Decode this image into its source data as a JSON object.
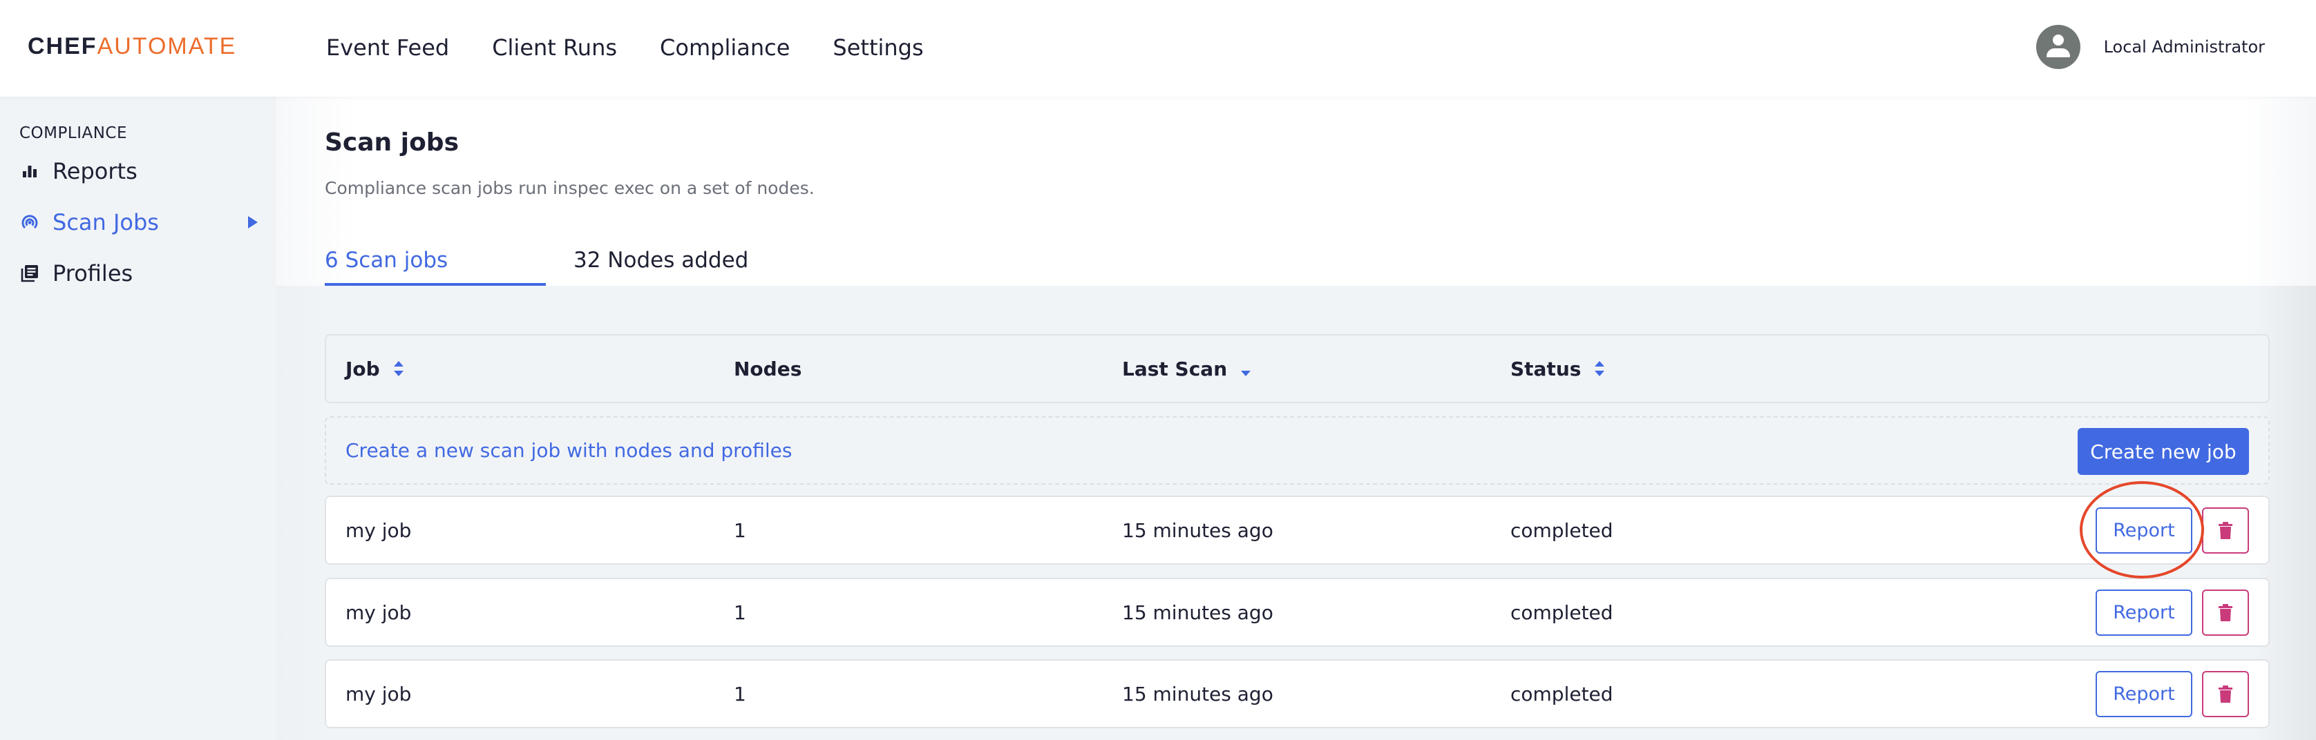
{
  "app": {
    "logo_part1": "CHEF",
    "logo_part2": "AUTOMATE",
    "brand_color": "#ed6d2c",
    "accent_color": "#4169e1",
    "danger_color": "#c93b7b"
  },
  "topnav": {
    "items": [
      {
        "label": "Event Feed"
      },
      {
        "label": "Client Runs"
      },
      {
        "label": "Compliance"
      },
      {
        "label": "Settings"
      }
    ],
    "user": {
      "name": "Local Administrator",
      "icon": "user-avatar-icon"
    }
  },
  "sidebar": {
    "heading": "COMPLIANCE",
    "items": [
      {
        "label": "Reports",
        "icon": "bar-chart-icon",
        "active": false
      },
      {
        "label": "Scan Jobs",
        "icon": "radar-icon",
        "active": true
      },
      {
        "label": "Profiles",
        "icon": "library-books-icon",
        "active": false
      }
    ]
  },
  "page": {
    "title": "Scan jobs",
    "description": "Compliance scan jobs run inspec exec on a set of nodes.",
    "tabs": [
      {
        "label": "6 Scan jobs",
        "active": true
      },
      {
        "label": "32 Nodes added",
        "active": false
      }
    ]
  },
  "table": {
    "columns": [
      {
        "label": "Job",
        "sort": "both"
      },
      {
        "label": "Nodes",
        "sort": "none"
      },
      {
        "label": "Last Scan",
        "sort": "desc"
      },
      {
        "label": "Status",
        "sort": "both"
      }
    ],
    "create_row": {
      "link_text": "Create a new scan job with nodes and profiles",
      "button_label": "Create new job"
    },
    "rows": [
      {
        "job": "my job",
        "nodes": "1",
        "last_scan": "15 minutes ago",
        "status": "completed",
        "report_label": "Report",
        "highlighted": true
      },
      {
        "job": "my job",
        "nodes": "1",
        "last_scan": "15 minutes ago",
        "status": "completed",
        "report_label": "Report",
        "highlighted": false
      },
      {
        "job": "my job",
        "nodes": "1",
        "last_scan": "15 minutes ago",
        "status": "completed",
        "report_label": "Report",
        "highlighted": false
      }
    ]
  }
}
